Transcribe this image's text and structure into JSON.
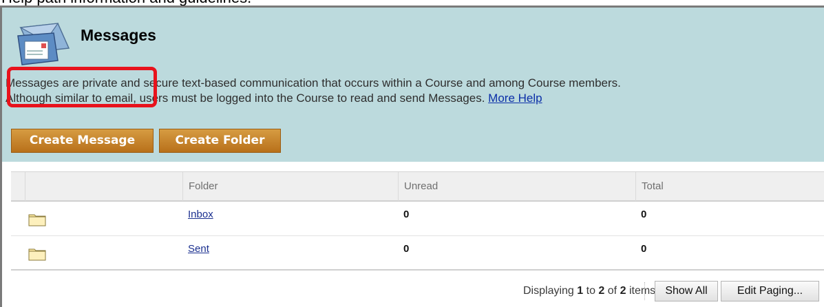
{
  "caption": {
    "text": "Help path information and guidelines."
  },
  "header": {
    "title": "Messages",
    "description_line1": "Messages are private and secure text-based communication that occurs within a Course and among Course members.",
    "description_line2": "Although similar to email, users must be logged into the Course to read and send Messages.",
    "more_help_label": "More Help",
    "icon": "messages-envelope-icon"
  },
  "actions": {
    "create_message_label": "Create Message",
    "create_folder_label": "Create Folder"
  },
  "table": {
    "columns": [
      "Folder",
      "Unread",
      "Total"
    ],
    "rows": [
      {
        "folder": "Inbox",
        "unread": "0",
        "total": "0",
        "icon": "folder-icon"
      },
      {
        "folder": "Sent",
        "unread": "0",
        "total": "0",
        "icon": "folder-icon"
      }
    ]
  },
  "paging": {
    "prefix": "Displaying",
    "from": "1",
    "to_word": "to",
    "to": "2",
    "of_word": "of",
    "total": "2",
    "suffix": "items",
    "show_all_label": "Show All",
    "edit_paging_label": "Edit Paging..."
  },
  "colors": {
    "header_bg": "#bcdadd",
    "button_orange": "#c98a2e",
    "highlight_red": "#e8121c",
    "link_blue": "#1a2f8f"
  }
}
